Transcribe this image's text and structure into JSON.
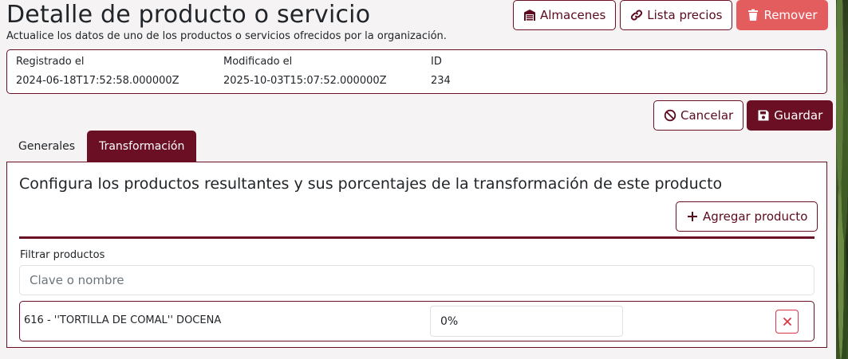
{
  "header": {
    "title": "Detalle de producto o servicio",
    "subtitle": "Actualice los datos de uno de los productos o servicios ofrecidos por la organización."
  },
  "top_actions": {
    "warehouses_label": "Almacenes",
    "price_list_label": "Lista precios",
    "remove_label": "Remover"
  },
  "info": {
    "registered_label": "Registrado el",
    "registered_value": "2024-06-18T17:52:58.000000Z",
    "modified_label": "Modificado el",
    "modified_value": "2025-10-03T15:07:52.000000Z",
    "id_label": "ID",
    "id_value": "234"
  },
  "form_actions": {
    "cancel_label": "Cancelar",
    "save_label": "Guardar"
  },
  "tabs": [
    {
      "label": "Generales",
      "active": false
    },
    {
      "label": "Transformación",
      "active": true
    }
  ],
  "transformation": {
    "title": "Configura los productos resultantes y sus porcentajes de la transformación de este producto",
    "add_product_label": "Agregar producto",
    "filter_label": "Filtrar productos",
    "filter_placeholder": "Clave o nombre",
    "products": [
      {
        "name": "616 - ''TORTILLA DE COMAL'' DOCENA",
        "percentage": "0%"
      }
    ]
  },
  "colors": {
    "primary": "#6b0f24",
    "danger": "#e35d5f",
    "remove_x": "#dc3545"
  },
  "icons": {
    "warehouses": "warehouse-icon",
    "price_list": "link-icon",
    "remove": "trash-icon",
    "cancel": "ban-icon",
    "save": "floppy-disk-icon",
    "add": "plus-icon",
    "remove_row": "close-icon"
  }
}
